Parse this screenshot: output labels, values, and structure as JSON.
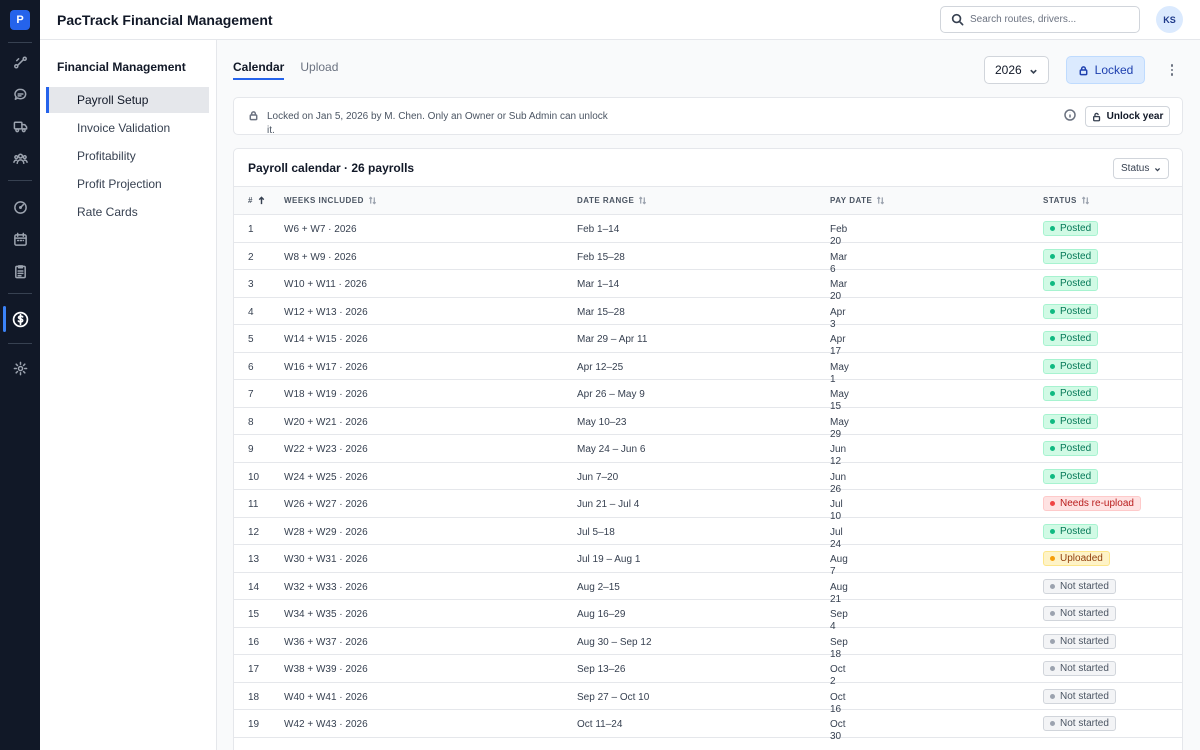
{
  "app": {
    "logo_letter": "P",
    "title": "PacTrack Financial Management",
    "search_placeholder": "Search routes, drivers...",
    "user_initials": "KS"
  },
  "rail_icons": [
    "routes-icon",
    "messages-icon",
    "truck-icon",
    "team-icon",
    "dashboard-icon",
    "calendar-icon",
    "clipboard-icon",
    "dollar-icon",
    "settings-icon"
  ],
  "subnav": {
    "title": "Financial Management",
    "items": [
      {
        "label": "Payroll Setup",
        "active": true
      },
      {
        "label": "Invoice Validation",
        "active": false
      },
      {
        "label": "Profitability",
        "active": false
      },
      {
        "label": "Profit Projection",
        "active": false
      },
      {
        "label": "Rate Cards",
        "active": false
      }
    ]
  },
  "tabs": [
    {
      "label": "Calendar",
      "active": true
    },
    {
      "label": "Upload",
      "active": false
    }
  ],
  "toolbar": {
    "year": "2026",
    "locked_label": "Locked"
  },
  "banner": {
    "message": "Locked on Jan 5, 2026 by M. Chen. Only an Owner or Sub Admin can unlock it.",
    "unlock_label": "Unlock year"
  },
  "table": {
    "title": "Payroll calendar · 26 payrolls",
    "status_filter": "Status",
    "columns": [
      "#",
      "WEEKS INCLUDED",
      "DATE RANGE",
      "PAY DATE",
      "STATUS"
    ],
    "status_colors": {
      "Posted": "#10b981",
      "Needs re-upload": "#ef4444",
      "Uploaded": "#f59e0b",
      "Not started": "#9ca3af"
    },
    "rows": [
      {
        "num": "1",
        "weeks": "W6 + W7 · 2026",
        "range": "Feb 1–14",
        "pay": "Feb 20",
        "status": "Posted"
      },
      {
        "num": "2",
        "weeks": "W8 + W9 · 2026",
        "range": "Feb 15–28",
        "pay": "Mar 6",
        "status": "Posted"
      },
      {
        "num": "3",
        "weeks": "W10 + W11 · 2026",
        "range": "Mar 1–14",
        "pay": "Mar 20",
        "status": "Posted"
      },
      {
        "num": "4",
        "weeks": "W12 + W13 · 2026",
        "range": "Mar 15–28",
        "pay": "Apr 3",
        "status": "Posted"
      },
      {
        "num": "5",
        "weeks": "W14 + W15 · 2026",
        "range": "Mar 29 – Apr 11",
        "pay": "Apr 17",
        "status": "Posted"
      },
      {
        "num": "6",
        "weeks": "W16 + W17 · 2026",
        "range": "Apr 12–25",
        "pay": "May 1",
        "status": "Posted"
      },
      {
        "num": "7",
        "weeks": "W18 + W19 · 2026",
        "range": "Apr 26 – May 9",
        "pay": "May 15",
        "status": "Posted"
      },
      {
        "num": "8",
        "weeks": "W20 + W21 · 2026",
        "range": "May 10–23",
        "pay": "May 29",
        "status": "Posted"
      },
      {
        "num": "9",
        "weeks": "W22 + W23 · 2026",
        "range": "May 24 – Jun 6",
        "pay": "Jun 12",
        "status": "Posted"
      },
      {
        "num": "10",
        "weeks": "W24 + W25 · 2026",
        "range": "Jun 7–20",
        "pay": "Jun 26",
        "status": "Posted"
      },
      {
        "num": "11",
        "weeks": "W26 + W27 · 2026",
        "range": "Jun 21 – Jul 4",
        "pay": "Jul 10",
        "status": "Needs re-upload"
      },
      {
        "num": "12",
        "weeks": "W28 + W29 · 2026",
        "range": "Jul 5–18",
        "pay": "Jul 24",
        "status": "Posted"
      },
      {
        "num": "13",
        "weeks": "W30 + W31 · 2026",
        "range": "Jul 19 – Aug 1",
        "pay": "Aug 7",
        "status": "Uploaded"
      },
      {
        "num": "14",
        "weeks": "W32 + W33 · 2026",
        "range": "Aug 2–15",
        "pay": "Aug 21",
        "status": "Not started"
      },
      {
        "num": "15",
        "weeks": "W34 + W35 · 2026",
        "range": "Aug 16–29",
        "pay": "Sep 4",
        "status": "Not started"
      },
      {
        "num": "16",
        "weeks": "W36 + W37 · 2026",
        "range": "Aug 30 – Sep 12",
        "pay": "Sep 18",
        "status": "Not started"
      },
      {
        "num": "17",
        "weeks": "W38 + W39 · 2026",
        "range": "Sep 13–26",
        "pay": "Oct 2",
        "status": "Not started"
      },
      {
        "num": "18",
        "weeks": "W40 + W41 · 2026",
        "range": "Sep 27 – Oct 10",
        "pay": "Oct 16",
        "status": "Not started"
      },
      {
        "num": "19",
        "weeks": "W42 + W43 · 2026",
        "range": "Oct 11–24",
        "pay": "Oct 30",
        "status": "Not started"
      }
    ]
  }
}
